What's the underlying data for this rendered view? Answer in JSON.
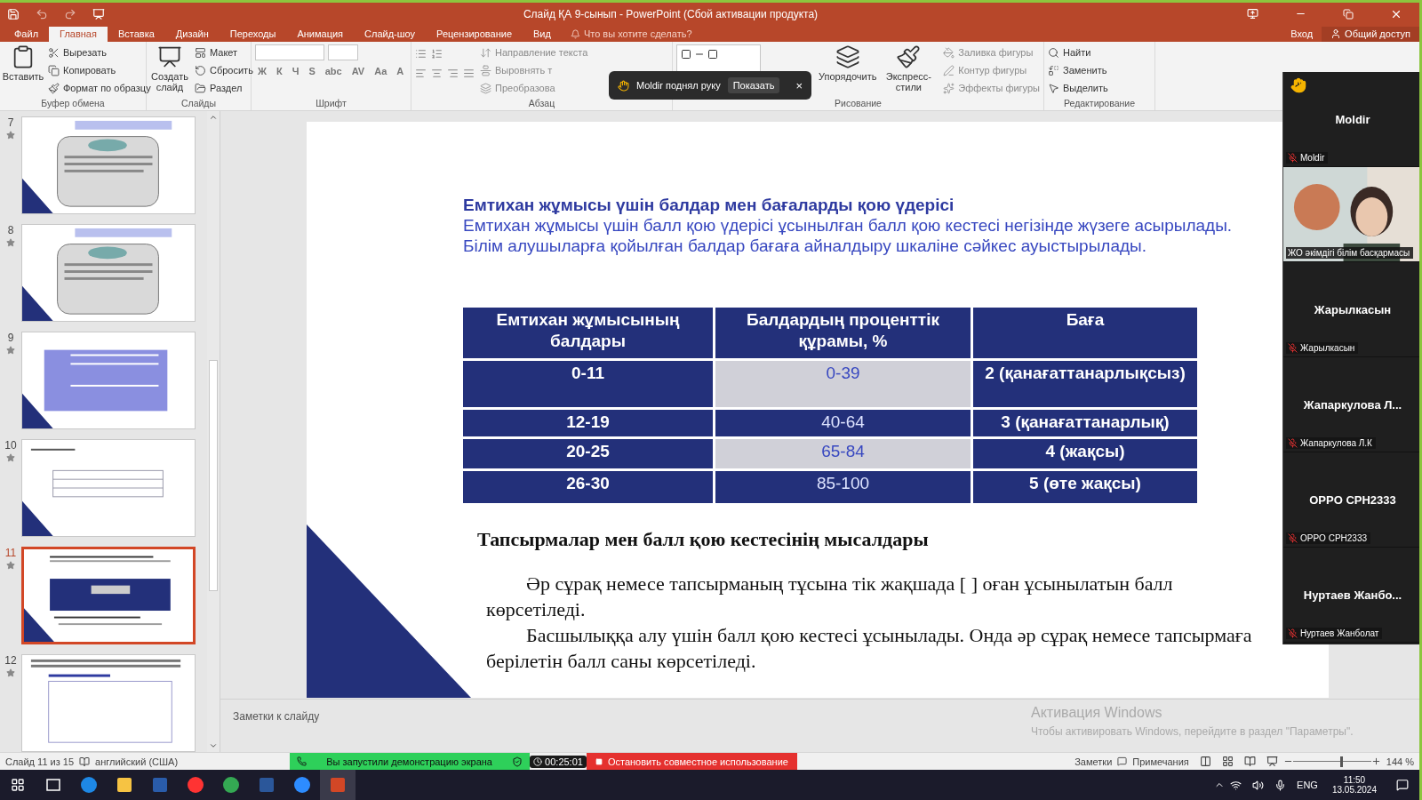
{
  "window": {
    "title": "Слайд ҚА 9-сынып - PowerPoint (Сбой активации продукта)"
  },
  "tabs": [
    {
      "label": "Файл",
      "selected": false
    },
    {
      "label": "Главная",
      "selected": true
    },
    {
      "label": "Вставка",
      "selected": false
    },
    {
      "label": "Дизайн",
      "selected": false
    },
    {
      "label": "Переходы",
      "selected": false
    },
    {
      "label": "Анимация",
      "selected": false
    },
    {
      "label": "Слайд-шоу",
      "selected": false
    },
    {
      "label": "Рецензирование",
      "selected": false
    },
    {
      "label": "Вид",
      "selected": false
    }
  ],
  "tell_me": {
    "placeholder": "Что вы хотите сделать?"
  },
  "account": {
    "sign_in": "Вход",
    "share": "Общий доступ"
  },
  "ribbon": [
    {
      "kind": "buttons",
      "label": "Буфер обмена",
      "large": [
        {
          "label": "Вставить",
          "kind": "paste"
        }
      ],
      "small": [
        {
          "label": "Вырезать",
          "kind": "cut",
          "disabled": false
        },
        {
          "label": "Копировать",
          "kind": "copy",
          "disabled": false
        },
        {
          "label": "Формат по образцу",
          "kind": "brush",
          "disabled": false
        }
      ]
    },
    {
      "kind": "buttons",
      "label": "Слайды",
      "large": [
        {
          "label": "Создать слайд",
          "kind": "new-slide"
        }
      ],
      "small": [
        {
          "label": "Макет",
          "kind": "layout",
          "disabled": false
        },
        {
          "label": "Сбросить",
          "kind": "reset",
          "disabled": false
        },
        {
          "label": "Раздел",
          "kind": "section",
          "disabled": false
        }
      ]
    },
    {
      "kind": "font",
      "label": "Шрифт",
      "glyphs": [
        "Ж",
        "К",
        "Ч",
        "S",
        "abc",
        "AV",
        "Aa",
        "A"
      ]
    },
    {
      "kind": "paragraph",
      "label": "Абзац",
      "small": [
        {
          "label": "Направление текста",
          "kind": "text-direction",
          "disabled": true
        },
        {
          "label": "Выровнять т",
          "kind": "align",
          "disabled": true
        },
        {
          "label": "Преобразова",
          "kind": "convert",
          "disabled": true
        }
      ]
    },
    {
      "kind": "drawing",
      "label": "Рисование",
      "large": [
        {
          "label": "Упорядочить",
          "kind": "arrange"
        },
        {
          "label": "Экспресс-стили",
          "kind": "styles"
        }
      ],
      "small": [
        {
          "label": "Заливка фигуры",
          "kind": "fill",
          "disabled": true
        },
        {
          "label": "Контур фигуры",
          "kind": "outline",
          "disabled": true
        },
        {
          "label": "Эффекты фигуры",
          "kind": "effects",
          "disabled": true
        }
      ]
    },
    {
      "kind": "buttons",
      "label": "Редактирование",
      "small": [
        {
          "label": "Найти",
          "kind": "find",
          "disabled": false
        },
        {
          "label": "Заменить",
          "kind": "replace",
          "disabled": false
        },
        {
          "label": "Выделить",
          "kind": "select",
          "disabled": false
        }
      ]
    }
  ],
  "toast": {
    "message": "Moldir поднял руку",
    "action": "Показать",
    "close": "×"
  },
  "thumbnails": [
    {
      "number": "7",
      "kind": "rounded-card",
      "selected": false
    },
    {
      "number": "8",
      "kind": "rounded-card",
      "selected": false
    },
    {
      "number": "9",
      "kind": "table-purple",
      "selected": false
    },
    {
      "number": "10",
      "kind": "table-plain",
      "selected": false
    },
    {
      "number": "11",
      "kind": "table-navy",
      "selected": true
    },
    {
      "number": "12",
      "kind": "text-doc",
      "selected": false
    }
  ],
  "slide": {
    "heading": "Емтихан жұмысы үшін балдар мен бағаларды қою үдерісі",
    "intro": [
      "Емтихан жұмысы үшін балл қою үдерісі ұсынылған балл қою кестесі негізінде жүзеге асырылады.",
      "Білім алушыларға қойылған балдар бағаға айналдыру шкаліне сәйкес ауыстырылады."
    ],
    "table": {
      "columns": [
        "Емтихан жұмысының балдары",
        "Балдардың проценттік құрамы, %",
        "Баға"
      ],
      "rows": [
        {
          "cells": [
            "0-11",
            "0-39",
            "2 (қанағаттанарлықсыз)"
          ],
          "shaded": true
        },
        {
          "cells": [
            "12-19",
            "40-64",
            "3 (қанағаттанарлық)"
          ],
          "shaded": false
        },
        {
          "cells": [
            "20-25",
            "65-84",
            "4 (жақсы)"
          ],
          "shaded": true
        },
        {
          "cells": [
            "26-30",
            "85-100",
            "5 (өте жақсы)"
          ],
          "shaded": false
        }
      ]
    },
    "subheading": "Тапсырмалар мен балл қою кестесінің мысалдары",
    "paragraphs": [
      "Әр сұрақ немесе тапсырманың тұсына тік жақшада [ ] оған ұсынылатын балл көрсетіледі.",
      "Басшылыққа алу үшін балл қою кестесі ұсынылады. Онда әр сұрақ немесе тапсырмаға берілетін балл саны көрсетіледі."
    ]
  },
  "notes": {
    "placeholder": "Заметки к слайду"
  },
  "participants": [
    {
      "kind": "avatar",
      "display": "Moldir",
      "label": "Moldir",
      "hand_raised": true
    },
    {
      "kind": "video",
      "label": "ЖО әкімдігі білім басқармасы",
      "hand_raised": false
    },
    {
      "kind": "avatar",
      "display": "Жарылкасын",
      "label": "Жарылкасын",
      "hand_raised": false
    },
    {
      "kind": "avatar",
      "display": "Жапаркулова  Л...",
      "label": "Жапаркулова Л.К",
      "hand_raised": false
    },
    {
      "kind": "avatar",
      "display": "OPPO CPH2333",
      "label": "OPPO CPH2333",
      "hand_raised": false
    },
    {
      "kind": "avatar",
      "display": "Нуртаев  Жанбо...",
      "label": "Нуртаев Жанболат",
      "hand_raised": false
    }
  ],
  "activation": {
    "title": "Активация Windows",
    "hint": "Чтобы активировать Windows, перейдите в раздел \"Параметры\"."
  },
  "status_bar": {
    "slide": "Слайд 11 из 15",
    "language": "английский (США)",
    "sharing": "Вы запустили демонстрацию экрана",
    "timer": "00:25:01",
    "stop": "Остановить совместное использование",
    "notes": "Заметки",
    "comments": "Примечания",
    "zoom": "144 %",
    "zoom_slider": {
      "level": 0.6
    }
  },
  "taskbar": {
    "apps": [
      {
        "kind": "task-view"
      },
      {
        "kind": "edge"
      },
      {
        "kind": "explorer"
      },
      {
        "kind": "calculator"
      },
      {
        "kind": "yandex"
      },
      {
        "kind": "chrome"
      },
      {
        "kind": "word"
      },
      {
        "kind": "zoom"
      },
      {
        "kind": "powerpoint",
        "selected": true
      }
    ],
    "language": "ENG",
    "time": "11:50",
    "date": "13.05.2024"
  }
}
